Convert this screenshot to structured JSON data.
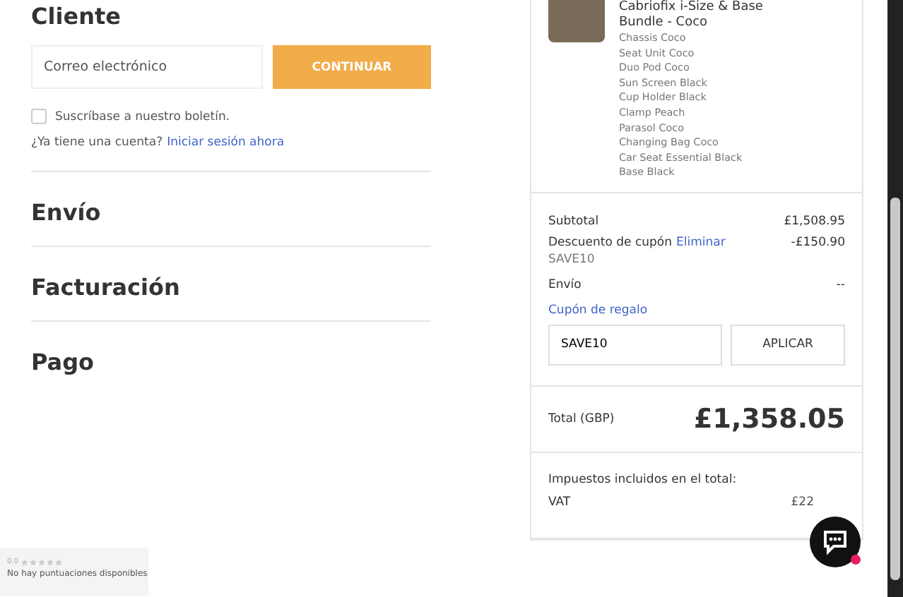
{
  "customer": {
    "heading": "Cliente",
    "email": {
      "placeholder": "Correo electrónico"
    },
    "continue_button": "CONTINUAR",
    "newsletter": {
      "label": "Suscríbase a nuestro boletín.",
      "checked": false
    },
    "account_prompt": "¿Ya tiene una cuenta?",
    "sign_in_link": "Iniciar sesión ahora"
  },
  "sections": [
    "Envío",
    "Facturación",
    "Pago"
  ],
  "product": {
    "title": "Cabriofix i-Size & Base Bundle - Coco",
    "options": [
      "Chassis Coco",
      "Seat Unit Coco",
      "Duo Pod Coco",
      "Sun Screen Black",
      "Cup Holder Black",
      "Clamp Peach",
      "Parasol Coco",
      "Changing Bag Coco",
      "Car Seat Essential Black",
      "Base Black"
    ]
  },
  "summary": {
    "subtotal_label": "Subtotal",
    "subtotal": "£1,508.95",
    "discount_label": "Descuento de cupón",
    "remove_link": "Eliminar",
    "discount": "-£150.90",
    "coupon_code": "SAVE10",
    "shipping_label": "Envío",
    "shipping": "--",
    "gift_coupon_link": "Cupón de regalo",
    "coupon_field": {
      "value": "SAVE10"
    },
    "apply_button": "APLICAR"
  },
  "total": {
    "label": "Total (GBP)",
    "value": "£1,358.05"
  },
  "taxes": {
    "heading": "Impuestos incluidos en el total:",
    "label": "VAT",
    "value": "£22"
  },
  "rating_widget": {
    "score": "0.0",
    "stars": 0,
    "text": "No hay puntuaciones disponibles"
  }
}
